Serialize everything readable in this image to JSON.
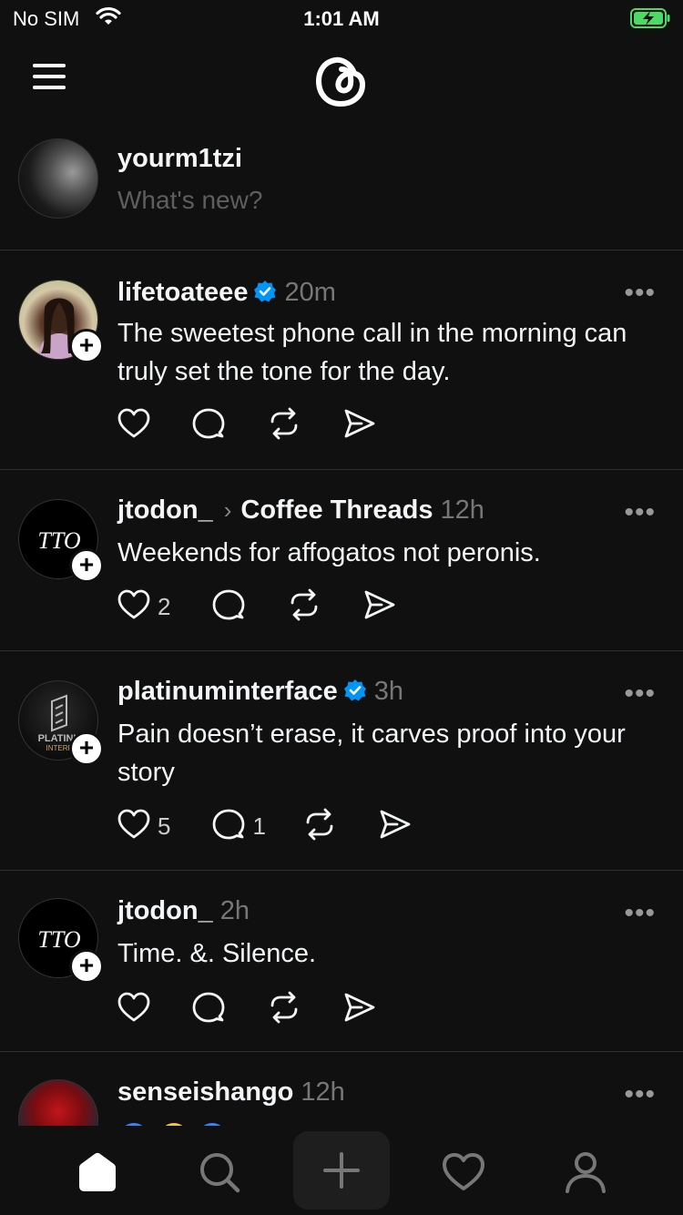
{
  "status": {
    "carrier": "No SIM",
    "time": "1:01 AM",
    "battery": "charging"
  },
  "header": {
    "menu_icon": "hamburger-menu-icon",
    "logo_icon": "threads-logo-icon"
  },
  "composer": {
    "username": "yourm1tzi",
    "placeholder": "What's new?"
  },
  "posts": [
    {
      "username": "lifetoateee",
      "verified": true,
      "community": "",
      "time": "20m",
      "text": "The sweetest phone call in the morning can truly set the tone for the day.",
      "likes": "",
      "replies": ""
    },
    {
      "username": "jtodon_",
      "verified": false,
      "community": "Coffee Threads",
      "time": "12h",
      "text": "Weekends for affogatos not peronis.",
      "likes": "2",
      "replies": ""
    },
    {
      "username": "platinuminterface",
      "verified": true,
      "community": "",
      "time": "3h",
      "text": "Pain doesn’t erase, it carves proof into your story",
      "likes": "5",
      "replies": "1"
    },
    {
      "username": "jtodon_",
      "verified": false,
      "community": "",
      "time": "2h",
      "text": "Time. &. Silence.",
      "likes": "",
      "replies": ""
    },
    {
      "username": "senseishango",
      "verified": false,
      "community": "",
      "time": "12h",
      "text": "",
      "likes": "",
      "replies": ""
    }
  ],
  "avatar_text": {
    "jtodon": "TTO",
    "platinum_line1": "PLATINU",
    "platinum_line2": "INTERF"
  },
  "more_label": "•••",
  "colors": {
    "background": "#101010",
    "verified": "#0095f6",
    "muted": "#777777",
    "battery": "#4cd964"
  },
  "bottom_nav": [
    "home-icon",
    "search-icon",
    "compose-plus-icon",
    "activity-heart-icon",
    "profile-icon"
  ]
}
